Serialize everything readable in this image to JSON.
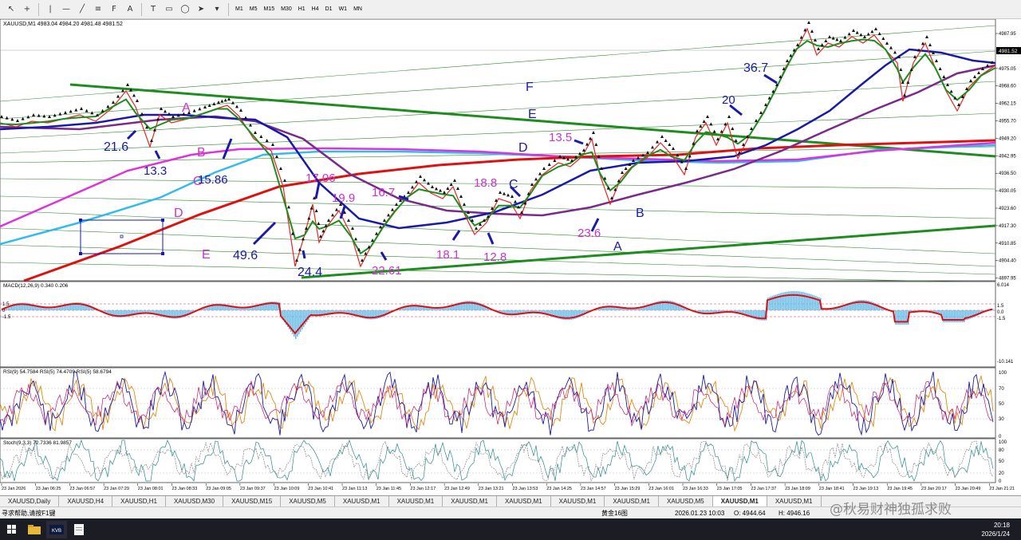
{
  "toolbar": {
    "tools": [
      "cursor-icon",
      "crosshair-icon",
      "vertical-line-icon",
      "horizontal-line-icon",
      "trendline-icon",
      "channel-icon",
      "fibonacci-icon",
      "text-icon",
      "label-icon",
      "rectangle-icon",
      "ellipse-icon",
      "arrow-icon",
      "more-icon"
    ],
    "timeframes": [
      "M1",
      "M5",
      "M15",
      "M30",
      "H1",
      "H4",
      "D1",
      "W1",
      "MN"
    ]
  },
  "main_chart": {
    "header": "XAUUSD,M1  4983.04 4984.20 4981.48 4981.52",
    "current_price": "4981.52",
    "price_axis": [
      "4987.95",
      "4981.52",
      "4975.05",
      "4968.60",
      "4962.15",
      "4955.70",
      "4949.20",
      "4942.95",
      "4936.50",
      "4930.05",
      "4923.60",
      "4917.30",
      "4910.85",
      "4904.40",
      "4897.95"
    ]
  },
  "annotations": [
    {
      "text": "A",
      "color": "#cc33cc"
    },
    {
      "text": "B",
      "color": "#cc33cc"
    },
    {
      "text": "O",
      "color": "#cc33cc"
    },
    {
      "text": "D",
      "color": "#cc33cc"
    },
    {
      "text": "E",
      "color": "#cc33cc"
    },
    {
      "text": "F",
      "color": "#1a1aa8"
    },
    {
      "text": "E",
      "color": "#1a1aa8"
    },
    {
      "text": "D",
      "color": "#1a1aa8"
    },
    {
      "text": "C",
      "color": "#1a1aa8"
    },
    {
      "text": "B",
      "color": "#1a1aa8"
    },
    {
      "text": "A",
      "color": "#1a1aa8"
    },
    {
      "text": "21.6",
      "color": "#1a1aa8"
    },
    {
      "text": "13.3",
      "color": "#1a1aa8"
    },
    {
      "text": "15.86",
      "color": "#1a1aa8"
    },
    {
      "text": "49.6",
      "color": "#1a1aa8"
    },
    {
      "text": "24.4",
      "color": "#1a1aa8"
    },
    {
      "text": "17.06",
      "color": "#cc33cc"
    },
    {
      "text": "19.9",
      "color": "#cc33cc"
    },
    {
      "text": "16.7",
      "color": "#cc33cc"
    },
    {
      "text": "22.61",
      "color": "#cc33cc"
    },
    {
      "text": "18.8",
      "color": "#cc33cc"
    },
    {
      "text": "18.1",
      "color": "#cc33cc"
    },
    {
      "text": "12.8",
      "color": "#cc33cc"
    },
    {
      "text": "13.5",
      "color": "#cc33cc"
    },
    {
      "text": "23.6",
      "color": "#cc33cc"
    },
    {
      "text": "20",
      "color": "#1a1aa8"
    },
    {
      "text": "36.7",
      "color": "#1a1aa8"
    }
  ],
  "macd": {
    "header": "MACD(12,26,9) 0.340 0.206",
    "axis": [
      "6.014",
      "1.5",
      "0.0",
      "-1.5",
      "-10.141"
    ],
    "levels": [
      "1.5",
      "0",
      "-1.5"
    ]
  },
  "rsi": {
    "header": "RSI(9) 54.7584  RSI(5) 74.4709  RSI(5) 58.6794",
    "axis": [
      "100",
      "70",
      "50",
      "30",
      "0"
    ]
  },
  "stoch": {
    "header": "Stoch(9,3,3) 72.7336 81.9857",
    "axis": [
      "100",
      "80",
      "50",
      "20",
      "0"
    ]
  },
  "time_axis": [
    "23 Jan 2026",
    "23 Jan 06:25",
    "23 Jan 06:57",
    "23 Jan 07:29",
    "23 Jan 08:01",
    "23 Jan 08:33",
    "23 Jan 09:05",
    "23 Jan 09:37",
    "23 Jan 10:09",
    "23 Jan 10:41",
    "23 Jan 11:13",
    "23 Jan 11:45",
    "23 Jan 12:17",
    "23 Jan 12:49",
    "23 Jan 13:21",
    "23 Jan 13:53",
    "23 Jan 14:25",
    "23 Jan 14:57",
    "23 Jan 15:29",
    "23 Jan 16:01",
    "23 Jan 16:33",
    "23 Jan 17:05",
    "23 Jan 17:37",
    "23 Jan 18:09",
    "23 Jan 18:41",
    "23 Jan 19:13",
    "23 Jan 19:45",
    "23 Jan 20:17",
    "23 Jan 20:49",
    "23 Jan 21:21"
  ],
  "tabs": [
    {
      "label": "XAUUSD,Daily",
      "active": false
    },
    {
      "label": "XAUUSD,H4",
      "active": false
    },
    {
      "label": "XAUUSD,H1",
      "active": false
    },
    {
      "label": "XAUUSD,M30",
      "active": false
    },
    {
      "label": "XAUUSD,M15",
      "active": false
    },
    {
      "label": "XAUUSD,M5",
      "active": false
    },
    {
      "label": "XAUUSD,M1",
      "active": false
    },
    {
      "label": "XAUUSD,M1",
      "active": false
    },
    {
      "label": "XAUUSD,M1",
      "active": false
    },
    {
      "label": "XAUUSD,M1",
      "active": false
    },
    {
      "label": "XAUUSD,M1",
      "active": false
    },
    {
      "label": "XAUUSD,M1",
      "active": false
    },
    {
      "label": "XAUUSD,M5",
      "active": false
    },
    {
      "label": "XAUUSD,M1",
      "active": true
    },
    {
      "label": "XAUUSD,M1",
      "active": false
    }
  ],
  "status": {
    "help": "寻求帮助,请按F1键",
    "profile": "黄金16图",
    "datetime": "2026.01.23 10:03",
    "open": "O: 4944.64",
    "high": "H: 4946.16"
  },
  "watermark": "@秋易财神独孤求败",
  "taskbar": {
    "time": "20:18",
    "date": "2026/1/24"
  },
  "colors": {
    "ma_green": "#1f8c1f",
    "ma_blue": "#1a1aa8",
    "ma_purple": "#7a2a8a",
    "ma_red": "#dd1111",
    "ma_magenta": "#dd33dd",
    "ma_cyan": "#33bbee",
    "price": "#ee2222",
    "macd_hist": "#66bbee"
  }
}
